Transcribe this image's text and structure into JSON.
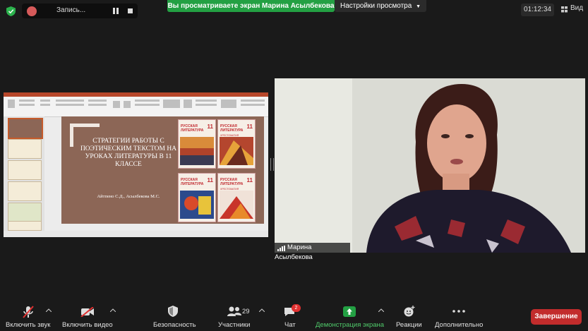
{
  "top_bar": {
    "recording_label": "Запись...",
    "share_banner": "Вы просматриваете экран Марина Асылбекова",
    "view_options_label": "Настройки просмотра",
    "timer": "01:12:34",
    "view_label": "Вид"
  },
  "slide": {
    "title": "СТРАТЕГИИ РАБОТЫ С ПОЭТИЧЕСКИМ ТЕКСТОМ НА УРОКАХ ЛИТЕРАТУРЫ В 11 КЛАССЕ",
    "authors": "Айтпено С.Д., Асылбекова М.С.",
    "books": [
      {
        "title": "РУССКАЯ ЛИТЕРАТУРА",
        "number": "11",
        "subtitle": ""
      },
      {
        "title": "РУССКАЯ ЛИТЕРАТУРА",
        "number": "11",
        "subtitle": "ХРЕСТОМАТИЯ"
      },
      {
        "title": "РУССКАЯ ЛИТЕРАТУРА",
        "number": "11",
        "subtitle": ""
      },
      {
        "title": "РУССКАЯ ЛИТЕРАТУРА",
        "number": "11",
        "subtitle": "ХРЕСТОМАТИЯ"
      }
    ]
  },
  "participant": {
    "name": "Марина Асылбекова"
  },
  "toolbar": {
    "mic_label": "Включить звук",
    "video_label": "Включить видео",
    "security_label": "Безопасность",
    "participants_label": "Участники",
    "participants_count": "29",
    "chat_label": "Чат",
    "chat_badge": "2",
    "share_label": "Демонстрация экрана",
    "reactions_label": "Реакции",
    "more_label": "Дополнительно",
    "end_label": "Завершение"
  },
  "colors": {
    "share_banner": "#23a043",
    "end_button": "#c22c2c",
    "slide_bg": "#8c6656",
    "book_title": "#c0282e"
  },
  "icons": [
    "shield-icon",
    "record-icon",
    "pause-icon",
    "stop-icon",
    "grid-icon",
    "signal-icon",
    "mic-off-icon",
    "video-off-icon",
    "security-icon",
    "participants-icon",
    "chat-icon",
    "share-screen-icon",
    "reactions-icon",
    "more-icon",
    "caret-up-icon"
  ]
}
